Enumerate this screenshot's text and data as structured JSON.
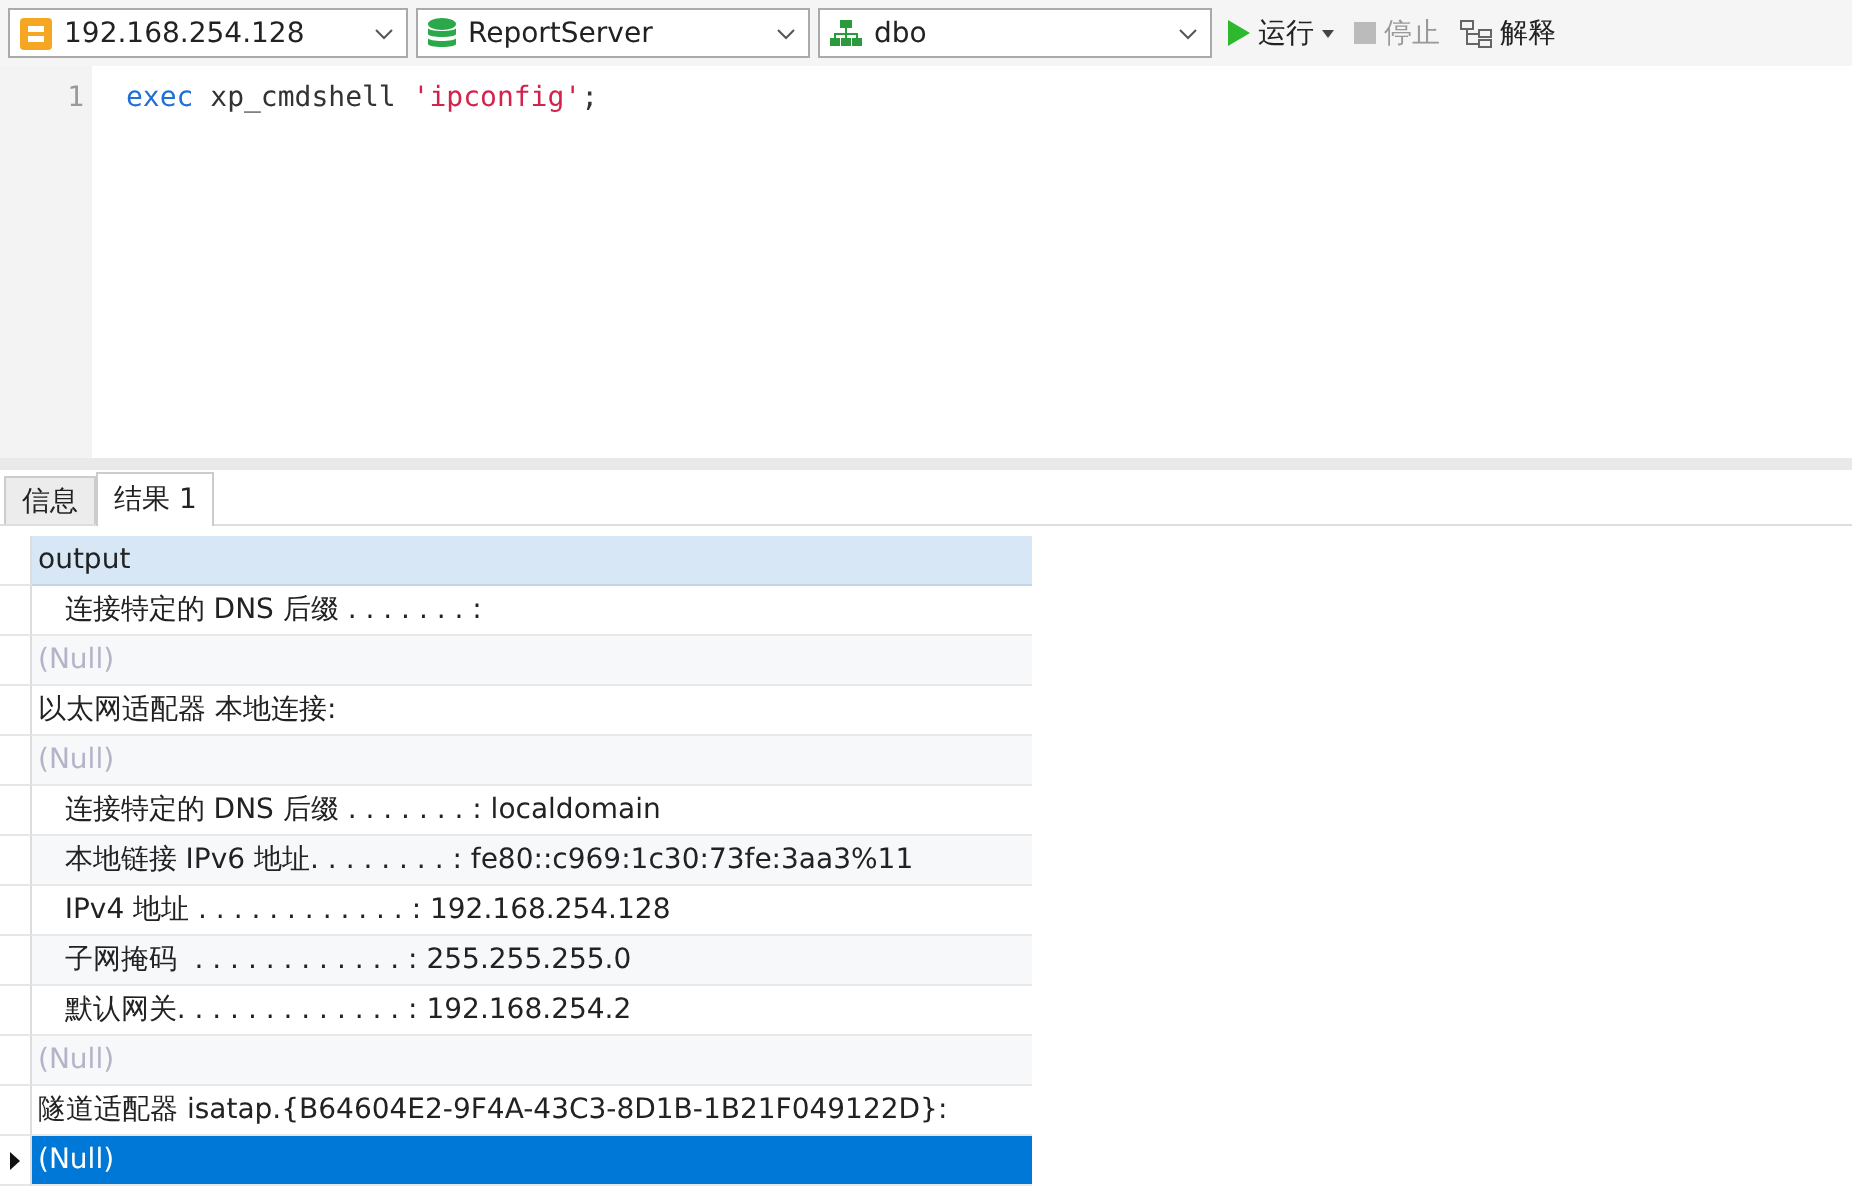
{
  "toolbar": {
    "connection": "192.168.254.128",
    "database": "ReportServer",
    "schema": "dbo",
    "buttons": [
      {
        "kind": "run",
        "label": "运行",
        "disabled": false
      },
      {
        "kind": "stop",
        "label": "停止",
        "disabled": true
      },
      {
        "kind": "explain",
        "label": "解释",
        "disabled": false
      }
    ]
  },
  "editor": {
    "lines": [
      {
        "number": "1",
        "tokens": [
          {
            "kind": "keyword",
            "text": "exec"
          },
          {
            "kind": "plain",
            "text": " xp_cmdshell "
          },
          {
            "kind": "string",
            "text": "'ipconfig'"
          },
          {
            "kind": "plain",
            "text": ";"
          }
        ]
      }
    ]
  },
  "tabs": [
    {
      "label": "信息",
      "selected": false
    },
    {
      "label": "结果 1",
      "selected": true
    }
  ],
  "grid": {
    "columns": [
      "output"
    ],
    "rows": [
      {
        "text": "   连接特定的 DNS 后缀 . . . . . . . :",
        "null": false,
        "selected": false
      },
      {
        "text": "(Null)",
        "null": true,
        "selected": false
      },
      {
        "text": "以太网适配器 本地连接:",
        "null": false,
        "selected": false
      },
      {
        "text": "(Null)",
        "null": true,
        "selected": false
      },
      {
        "text": "   连接特定的 DNS 后缀 . . . . . . . : localdomain",
        "null": false,
        "selected": false
      },
      {
        "text": "   本地链接 IPv6 地址. . . . . . . . : fe80::c969:1c30:73fe:3aa3%11",
        "null": false,
        "selected": false
      },
      {
        "text": "   IPv4 地址 . . . . . . . . . . . . : 192.168.254.128",
        "null": false,
        "selected": false
      },
      {
        "text": "   子网掩码  . . . . . . . . . . . . : 255.255.255.0",
        "null": false,
        "selected": false
      },
      {
        "text": "   默认网关. . . . . . . . . . . . . : 192.168.254.2",
        "null": false,
        "selected": false
      },
      {
        "text": "(Null)",
        "null": true,
        "selected": false
      },
      {
        "text": "隧道适配器 isatap.{B64604E2-9F4A-43C3-8D1B-1B21F049122D}:",
        "null": false,
        "selected": false
      },
      {
        "text": "(Null)",
        "null": true,
        "selected": true
      }
    ]
  }
}
